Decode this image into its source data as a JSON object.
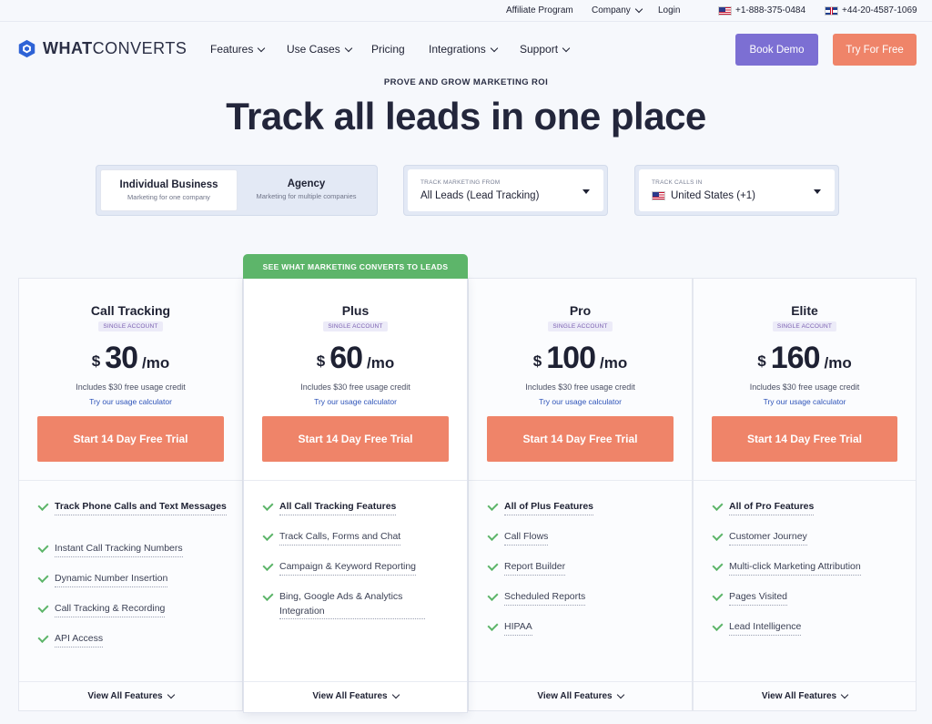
{
  "topbar": {
    "affiliate": "Affiliate Program",
    "company": "Company",
    "login": "Login",
    "phone_us": "+1-888-375-0484",
    "phone_uk": "+44-20-4587-1069"
  },
  "brand": {
    "logo_bold": "WHAT",
    "logo_light": "CONVERTS"
  },
  "nav": {
    "features": "Features",
    "use_cases": "Use Cases",
    "pricing": "Pricing",
    "integrations": "Integrations",
    "support": "Support",
    "book_demo": "Book Demo",
    "try_free": "Try For Free"
  },
  "hero": {
    "eyebrow": "PROVE AND GROW MARKETING ROI",
    "title": "Track all leads in one place"
  },
  "account_toggle": {
    "options": [
      {
        "title": "Individual Business",
        "subtitle": "Marketing for one company",
        "active": true
      },
      {
        "title": "Agency",
        "subtitle": "Marketing for multiple companies",
        "active": false
      }
    ]
  },
  "marketing_select": {
    "caption": "TRACK MARKETING FROM",
    "value": "All Leads (Lead Tracking)"
  },
  "calls_select": {
    "caption": "TRACK CALLS IN",
    "value": "United States (+1)"
  },
  "ribbon": "SEE WHAT MARKETING CONVERTS TO LEADS",
  "plans": [
    {
      "name": "Call Tracking",
      "badge": "SINGLE ACCOUNT",
      "currency": "$",
      "amount": "30",
      "period": "/mo",
      "credit": "Includes $30 free usage credit",
      "calc": "Try our usage calculator",
      "cta": "Start 14 Day Free Trial",
      "features": [
        "Track Phone Calls and Text Messages",
        "Instant Call Tracking Numbers",
        "Dynamic Number Insertion",
        "Call Tracking & Recording",
        "API Access"
      ],
      "view_all": "View All Features"
    },
    {
      "name": "Plus",
      "badge": "SINGLE ACCOUNT",
      "currency": "$",
      "amount": "60",
      "period": "/mo",
      "credit": "Includes $30 free usage credit",
      "calc": "Try our usage calculator",
      "cta": "Start 14 Day Free Trial",
      "features": [
        "All Call Tracking Features",
        "Track Calls, Forms and Chat",
        "Campaign & Keyword Reporting",
        "Bing, Google Ads & Analytics Integration"
      ],
      "view_all": "View All Features"
    },
    {
      "name": "Pro",
      "badge": "SINGLE ACCOUNT",
      "currency": "$",
      "amount": "100",
      "period": "/mo",
      "credit": "Includes $30 free usage credit",
      "calc": "Try our usage calculator",
      "cta": "Start 14 Day Free Trial",
      "features": [
        "All of Plus Features",
        "Call Flows",
        "Report Builder",
        "Scheduled Reports",
        "HIPAA"
      ],
      "view_all": "View All Features"
    },
    {
      "name": "Elite",
      "badge": "SINGLE ACCOUNT",
      "currency": "$",
      "amount": "160",
      "period": "/mo",
      "credit": "Includes $30 free usage credit",
      "calc": "Try our usage calculator",
      "cta": "Start 14 Day Free Trial",
      "features": [
        "All of Pro Features",
        "Customer Journey",
        "Multi-click Marketing Attribution",
        "Pages Visited",
        "Lead Intelligence"
      ],
      "view_all": "View All Features"
    }
  ]
}
